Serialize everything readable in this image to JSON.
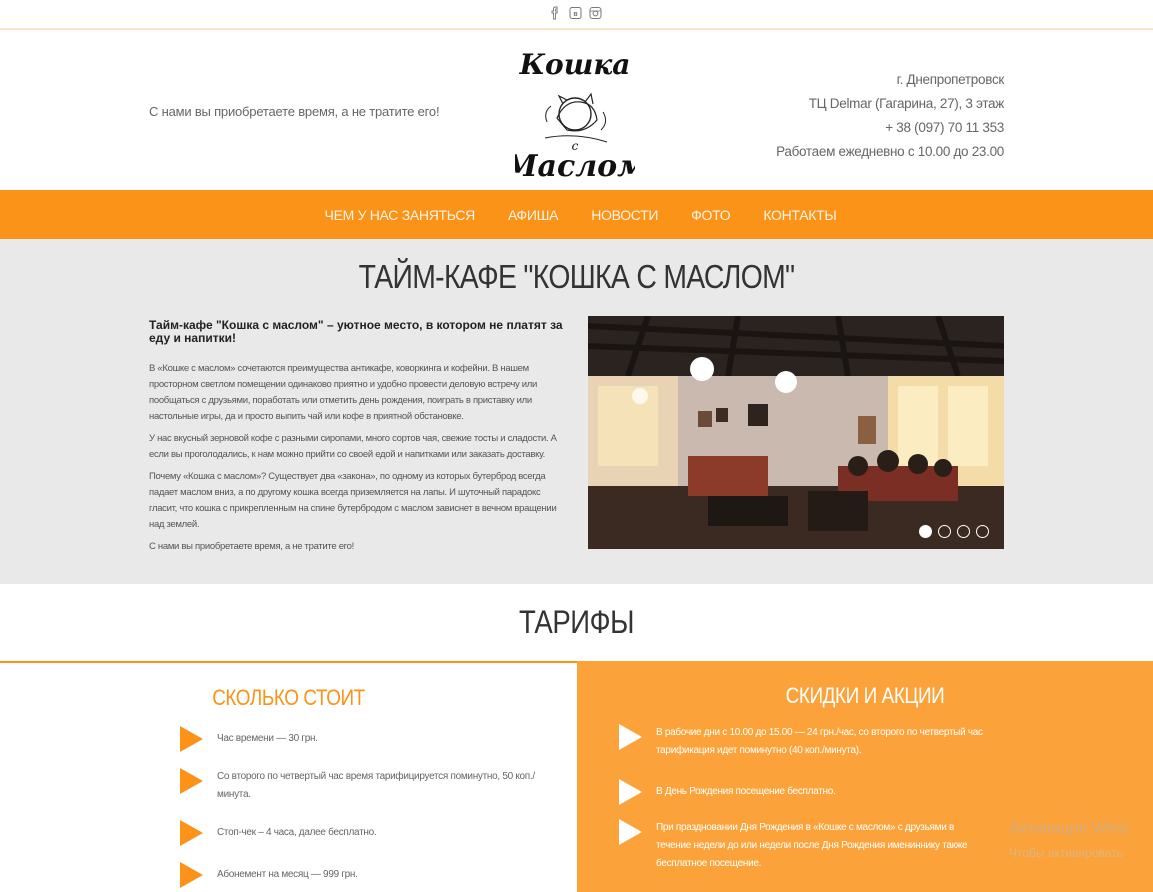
{
  "social": [
    "facebook-icon",
    "vk-icon",
    "instagram-icon"
  ],
  "header": {
    "slogan": "С нами вы приобретаете время, а не тратите его!",
    "logo_text": "Кошка с маслом",
    "contacts": [
      "г. Днепропетровск",
      "ТЦ Delmar (Гагарина, 27), 3 этаж",
      "+ 38 (097) 70 11 353",
      "Работаем ежедневно с 10.00 до 23.00"
    ]
  },
  "nav": {
    "items": [
      "ЧЕМ У НАС ЗАНЯТЬСЯ",
      "АФИША",
      "НОВОСТИ",
      "ФОТО",
      "КОНТАКТЫ"
    ]
  },
  "about": {
    "title": "ТАЙМ-КАФЕ \"КОШКА С МАСЛОМ\"",
    "subtitle": "Тайм-кафе \"Кошка с маслом\" – уютное место, в котором не платят за еду и напитки!",
    "paragraphs": [
      "В «Кошке с маслом» сочетаются преимущества антикафе, коворкинга и кофейни. В нашем просторном светлом помещении одинаково приятно и удобно провести деловую встречу или пообщаться с друзьями, поработать или отметить день рождения, поиграть в приставку или настольные игры, да и просто выпить чай или кофе в приятной обстановке.",
      "У нас вкусный зерновой кофе с разными сиропами, много сортов чая, свежие тосты и сладости. А если вы проголодались, к нам можно прийти со своей едой и напитками или заказать доставку.",
      "Почему «Кошка с маслом»? Существует два «закона», по одному из которых бутерброд всегда падает маслом вниз, а по другому кошка всегда приземляется на лапы. И шуточный парадокс гласит, что кошка с прикрепленным на спине бутербродом с маслом зависнет в вечном вращении над землей.",
      "С нами вы приобретаете время, а не тратите его!"
    ],
    "slider": {
      "slides": 4,
      "active": 1
    }
  },
  "tariffs": {
    "title": "ТАРИФЫ",
    "price": {
      "title": "СКОЛЬКО СТОИТ",
      "items": [
        "Час времени — 30 грн.",
        "Со второго по четвертый час время тарифицируется поминутно, 50 коп./минута.",
        "Стоп-чек – 4 часа, далее бесплатно.",
        "Абонемент на месяц — 999 грн."
      ]
    },
    "discounts": {
      "title": "СКИДКИ И АКЦИИ",
      "items": [
        "В рабочие дни с 10.00 до 15.00 — 24 грн./час, со второго по четвертый час тарификация идет поминутно (40 коп./минута).",
        "В День Рождения посещение бесплатно.",
        "При праздновании Дня Рождения в «Кошке с маслом» с друзьями в течение недели до или недели после Дня Рождения имениннику также бесплатное посещение."
      ]
    }
  },
  "watermark": {
    "line1": "Активация Wind",
    "line2": "Чтобы активировать"
  },
  "colors": {
    "accent": "#fb9318",
    "accent_light": "#fba33a",
    "about_bg": "#e9e9e9"
  }
}
